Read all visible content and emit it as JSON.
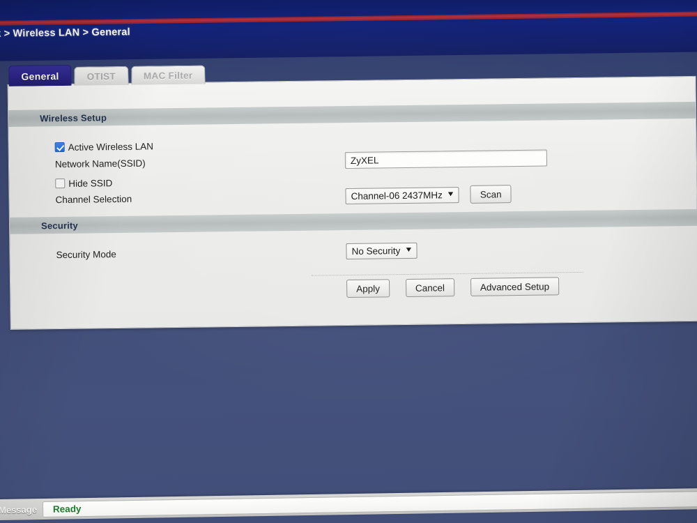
{
  "breadcrumb": {
    "text": "work > Wireless LAN > General"
  },
  "tabs": [
    {
      "label": "General",
      "active": true
    },
    {
      "label": "OTIST",
      "active": false
    },
    {
      "label": "MAC Filter",
      "active": false
    }
  ],
  "sections": {
    "wireless_setup": {
      "title": "Wireless Setup",
      "active_wireless_lan": {
        "label": "Active Wireless LAN",
        "checked": true
      },
      "ssid": {
        "label": "Network Name(SSID)",
        "value": "ZyXEL",
        "placeholder": ""
      },
      "hide_ssid": {
        "label": "Hide SSID",
        "checked": false
      },
      "channel_selection": {
        "label": "Channel Selection",
        "value": "Channel-06 2437MHz",
        "caret": "chevron-down-icon",
        "scan_button": "Scan"
      }
    },
    "security": {
      "title": "Security",
      "security_mode": {
        "label": "Security Mode",
        "value": "No Security",
        "caret": "chevron-down-icon"
      }
    }
  },
  "actions": {
    "apply": "Apply",
    "cancel": "Cancel",
    "advanced_setup": "Advanced Setup"
  },
  "status_bar": {
    "label": "Message",
    "value": "Ready"
  },
  "colors": {
    "desktop_background": "#3e4a73",
    "top_band": "#13237a",
    "red_stripe": "#b6313f",
    "active_tab": "#2b2588",
    "section_bar": "#b5bcbb",
    "status_ok": "#1f7a2e",
    "checkbox_checked": "#1f6ddf"
  }
}
